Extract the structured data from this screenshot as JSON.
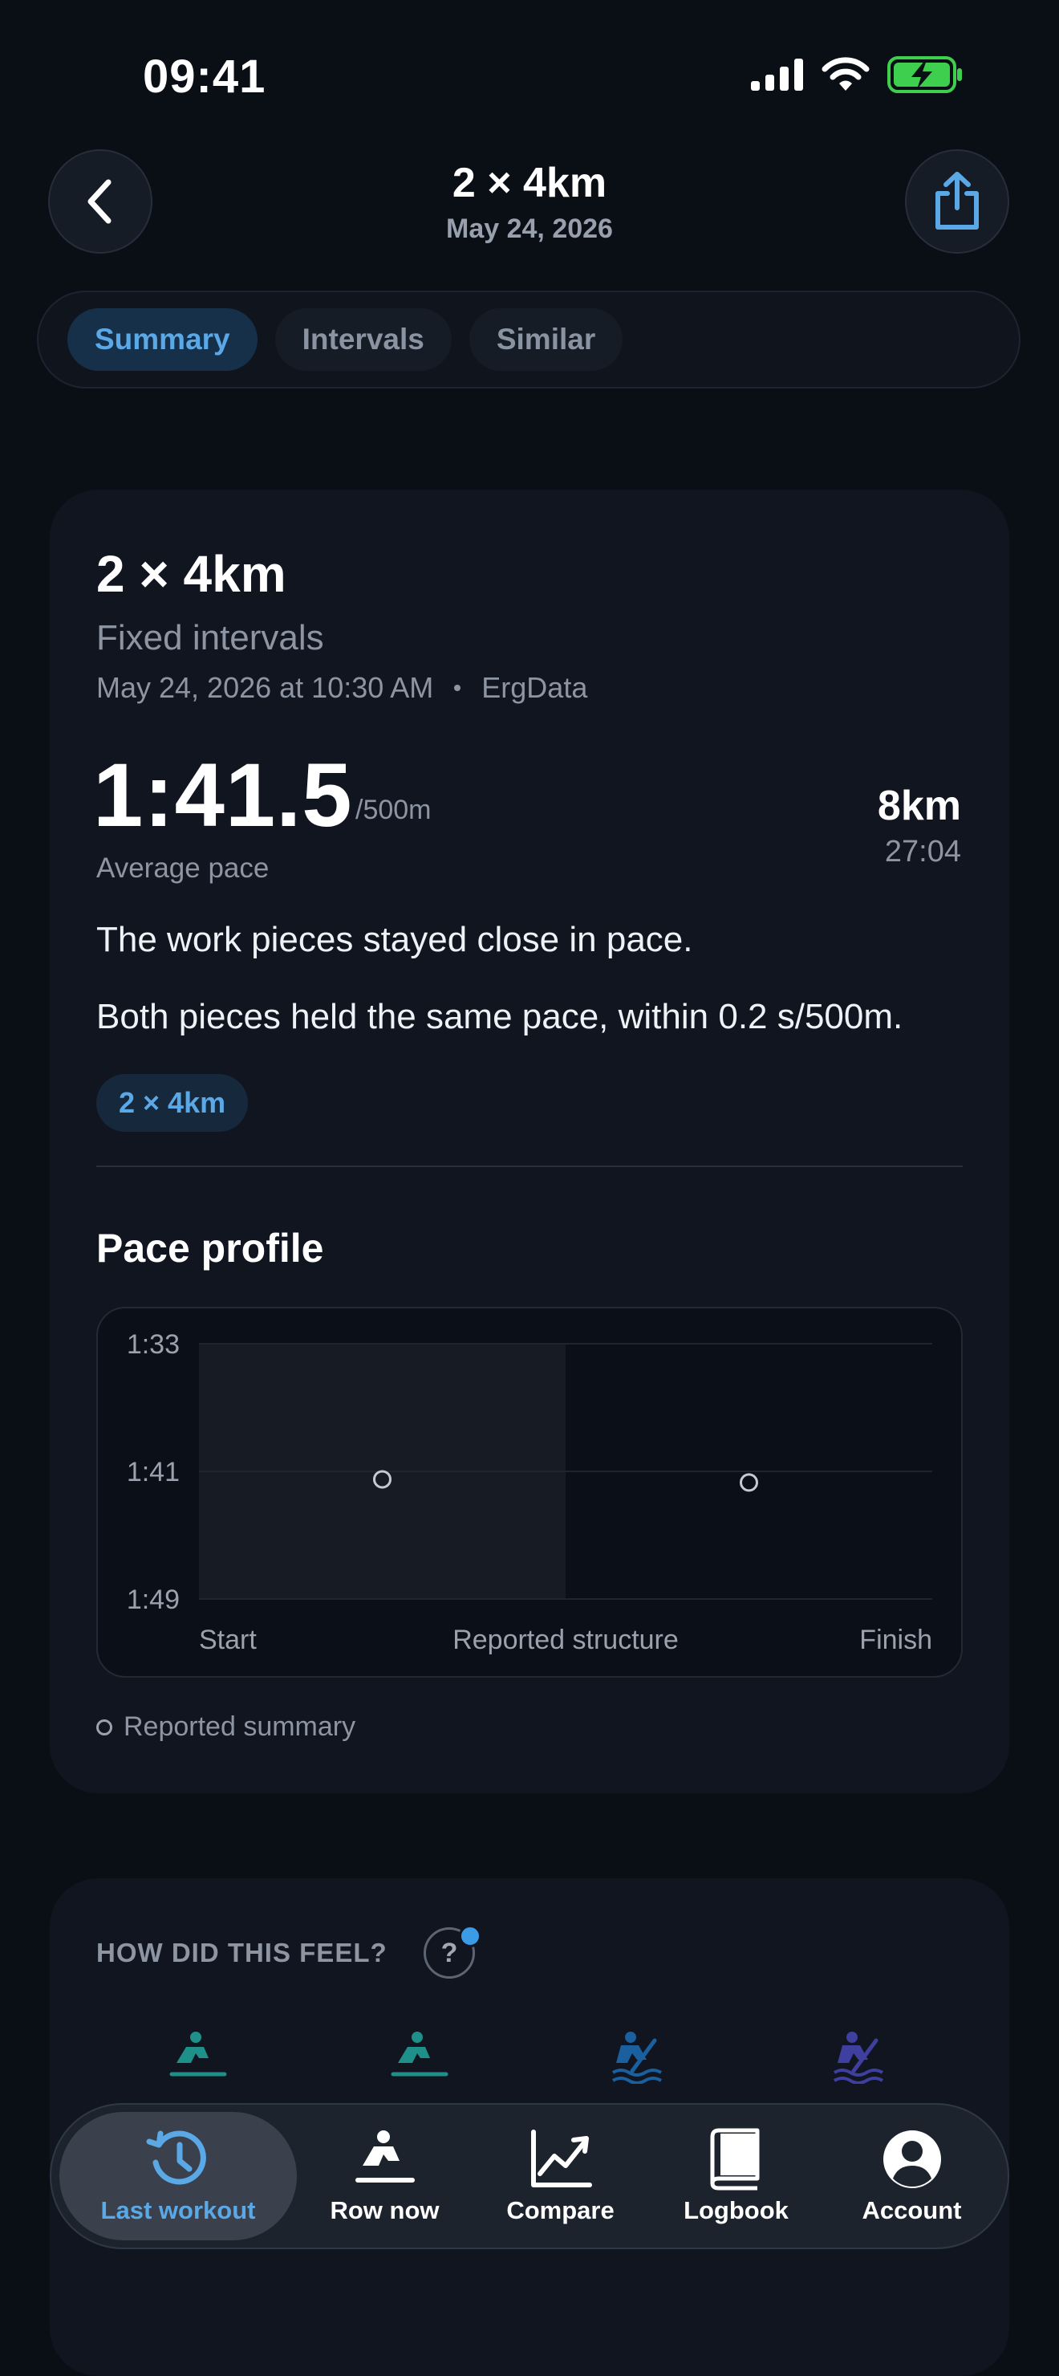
{
  "status_bar": {
    "time": "09:41"
  },
  "header": {
    "title": "2 × 4km",
    "date": "May 24, 2026"
  },
  "tabs": [
    {
      "label": "Summary",
      "active": true
    },
    {
      "label": "Intervals",
      "active": false
    },
    {
      "label": "Similar",
      "active": false
    }
  ],
  "summary": {
    "title": "2 × 4km",
    "type": "Fixed intervals",
    "datetime": "May 24, 2026 at 10:30 AM",
    "source": "ErgData",
    "pace": "1:41.5",
    "pace_unit": "/500m",
    "pace_label": "Average pace",
    "distance": "8km",
    "time": "27:04",
    "insight_1": "The work pieces stayed close in pace.",
    "insight_2": "Both pieces held the same pace, within 0.2 s/500m.",
    "chip": "2 × 4km"
  },
  "pace_profile": {
    "title": "Pace profile",
    "legend": "Reported summary"
  },
  "chart_data": {
    "type": "scatter",
    "y_ticks": [
      "1:33",
      "1:41",
      "1:49"
    ],
    "x_labels": [
      "Start",
      "Reported structure",
      "Finish"
    ],
    "ylim_seconds": [
      93,
      109
    ],
    "y_inverted": true,
    "segments": [
      {
        "start": 0,
        "end": 0.5,
        "shaded": true
      },
      {
        "start": 0.5,
        "end": 1.0,
        "shaded": false
      }
    ],
    "series": [
      {
        "name": "Reported summary",
        "x": [
          0.25,
          0.75
        ],
        "y_seconds": [
          101.5,
          101.7
        ],
        "style": "hollow-circle"
      }
    ],
    "grid": true
  },
  "feel": {
    "title": "HOW DID THIS FEEL?",
    "help": "?",
    "option_colors": [
      "#1f8f8a",
      "#1f8f8a",
      "#1a5f9e",
      "#3e3f9e"
    ]
  },
  "nav": [
    {
      "label": "Last workout",
      "icon": "history-icon",
      "active": true
    },
    {
      "label": "Row now",
      "icon": "rower-icon",
      "active": false
    },
    {
      "label": "Compare",
      "icon": "trend-chart-icon",
      "active": false
    },
    {
      "label": "Logbook",
      "icon": "book-icon",
      "active": false
    },
    {
      "label": "Account",
      "icon": "account-icon",
      "active": false
    }
  ],
  "colors": {
    "accent": "#5aa8e6",
    "background": "#0a0e15",
    "card": "#101520",
    "battery": "#3ecf4e"
  }
}
